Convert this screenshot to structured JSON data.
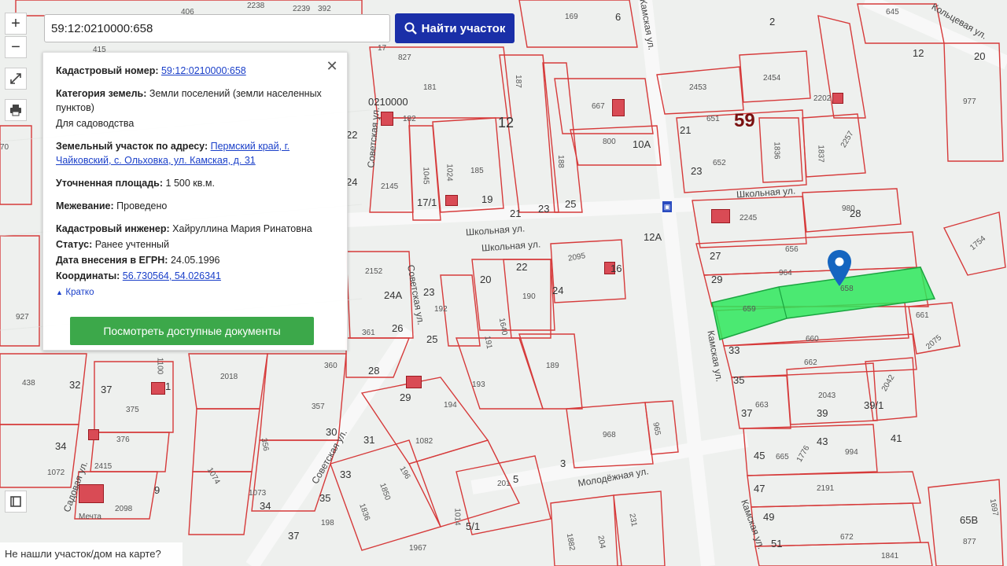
{
  "search": {
    "value": "59:12:0210000:658",
    "button_label": "Найти участок"
  },
  "controls": {
    "zoom_in": "+",
    "zoom_out": "−"
  },
  "info": {
    "cadastral_label": "Кадастровый номер:",
    "cadastral_value": "59:12:0210000:658",
    "category_label": "Категория земель:",
    "category_value": "Земли поселений (земли населенных пунктов)",
    "usage_value": "Для садоводства",
    "address_label": "Земельный участок по адресу:",
    "address_value": "Пермский край, г. Чайковский, с. Ольховка, ул. Камская, д. 31",
    "area_label": "Уточненная площадь:",
    "area_value": "1 500 кв.м.",
    "survey_label": "Межевание:",
    "survey_value": "Проведено",
    "engineer_label": "Кадастровый инженер:",
    "engineer_value": "Хайруллина Мария Ринатовна",
    "status_label": "Статус:",
    "status_value": "Ранее учтенный",
    "date_label": "Дата внесения в ЕГРН:",
    "date_value": "24.05.1996",
    "coords_label": "Координаты:",
    "coords_value": "56.730564, 54.026341",
    "brief_link": "Кратко",
    "docs_button": "Посмотреть доступные документы"
  },
  "footer": {
    "not_found": "Не нашли участок/дом на карте?"
  },
  "colors": {
    "parcel_line": "#d63a3a",
    "highlight": "#2ee85c",
    "search_button": "#1a2fa8",
    "docs_button": "#3ca84a",
    "pin": "#1565c0"
  },
  "map": {
    "streets": [
      "Школьная ул.",
      "Школьная ул.",
      "Школьная ул.",
      "Советская ул.",
      "Советская ул.",
      "Советская ул.",
      "Камская ул.",
      "Камская ул.",
      "Камская ул.",
      "Молодёжная ул.",
      "Садовая ул.",
      "Кольцевая ул."
    ],
    "numbers": [
      "59",
      "12",
      "12",
      "2",
      "17",
      "827",
      "181",
      "182",
      "0210000",
      "187",
      "667",
      "800",
      "10А",
      "2453",
      "2454",
      "651",
      "2202",
      "21",
      "23",
      "652",
      "1836",
      "1837",
      "2257",
      "645",
      "20",
      "977",
      "169",
      "6",
      "2145",
      "1045",
      "1024",
      "185",
      "188",
      "17/1",
      "19",
      "21",
      "23",
      "25",
      "2245",
      "980",
      "28",
      "1754",
      "12А",
      "2095",
      "16",
      "27",
      "656",
      "964",
      "29",
      "658",
      "659",
      "661",
      "2075",
      "660",
      "662",
      "33",
      "35",
      "2043",
      "2042",
      "39/1",
      "37",
      "663",
      "39",
      "2152",
      "24А",
      "23",
      "192",
      "20",
      "22",
      "190",
      "24",
      "1640",
      "191",
      "189",
      "26",
      "25",
      "361",
      "360",
      "28",
      "2018",
      "357",
      "29",
      "194",
      "193",
      "438",
      "32",
      "37",
      "375",
      "1100",
      "376",
      "2415",
      "34",
      "1074",
      "1073",
      "356",
      "30",
      "31",
      "1082",
      "201",
      "5",
      "3",
      "968",
      "965",
      "41",
      "43",
      "994",
      "45",
      "665",
      "1776",
      "47",
      "2191",
      "49",
      "51",
      "672",
      "1841",
      "33",
      "35",
      "198",
      "1836",
      "1850",
      "196",
      "34",
      "37",
      "1014",
      "5/1",
      "1967",
      "1882",
      "231",
      "204",
      "65В",
      "877",
      "1697",
      "927",
      "70",
      "22",
      "24",
      "1",
      "9",
      "Мечта",
      "2098",
      "1072",
      "415",
      "406",
      "2238",
      "2239",
      "392"
    ]
  }
}
